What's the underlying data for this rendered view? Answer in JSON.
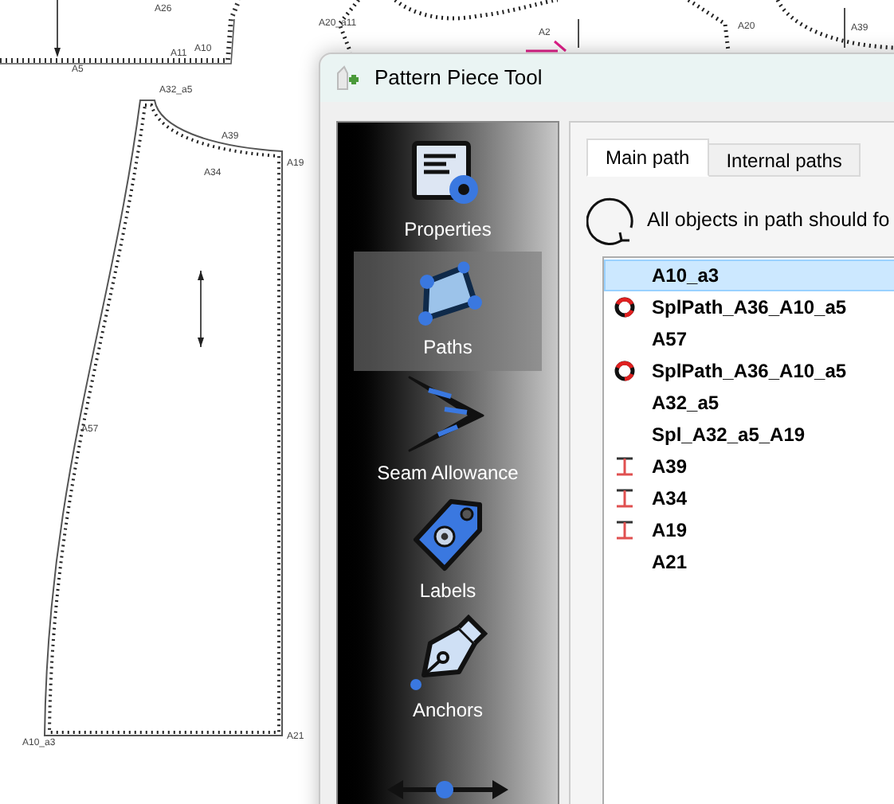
{
  "canvas": {
    "point_labels": [
      "A10_a3",
      "A21",
      "A57",
      "A19",
      "A39",
      "A34",
      "A32_a5",
      "A10",
      "A11",
      "A5",
      "A26",
      "A20_a11",
      "A2",
      "A20",
      "A39"
    ]
  },
  "dialog": {
    "title": "Pattern Piece Tool",
    "sidebar": {
      "items": [
        {
          "label": "Properties",
          "selected": false
        },
        {
          "label": "Paths",
          "selected": true
        },
        {
          "label": "Seam Allowance",
          "selected": false
        },
        {
          "label": "Labels",
          "selected": false
        },
        {
          "label": "Anchors",
          "selected": false
        },
        {
          "selected": false
        }
      ]
    },
    "tabs": [
      {
        "label": "Main path",
        "selected": true
      },
      {
        "label": "Internal paths",
        "selected": false
      }
    ],
    "notice": "All objects in path should fo",
    "path_items": [
      {
        "name": "A10_a3",
        "kind": "plain",
        "selected": true
      },
      {
        "name": "SplPath_A36_A10_a5",
        "kind": "curve",
        "selected": false
      },
      {
        "name": "A57",
        "kind": "plain",
        "selected": false
      },
      {
        "name": "SplPath_A36_A10_a5",
        "kind": "curve",
        "selected": false
      },
      {
        "name": "A32_a5",
        "kind": "plain",
        "selected": false
      },
      {
        "name": "Spl_A32_a5_A19",
        "kind": "plain",
        "selected": false
      },
      {
        "name": "A39",
        "kind": "notch",
        "selected": false
      },
      {
        "name": "A34",
        "kind": "notch",
        "selected": false
      },
      {
        "name": "A19",
        "kind": "notch",
        "selected": false
      },
      {
        "name": "A21",
        "kind": "plain",
        "selected": false
      }
    ]
  }
}
